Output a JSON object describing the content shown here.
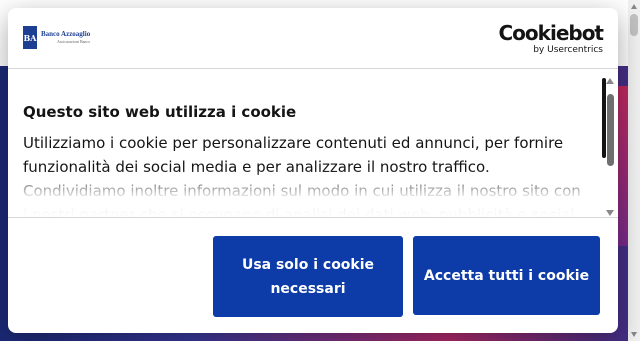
{
  "brand": {
    "mark": "BA",
    "name": "Banco Azzoaglio",
    "subtitle": "Assicurazioni Banco"
  },
  "cookiebot": {
    "word": "Cookiebot",
    "by": "by Usercentrics"
  },
  "consent": {
    "title": "Questo sito web utilizza i cookie",
    "text": "Utilizziamo i cookie per personalizzare contenuti ed annunci, per fornire funzionalità dei social media e per analizzare il nostro traffico. Condividiamo inoltre informazioni sul modo in cui utilizza il nostro sito con i nostri partner che si occupano di analisi dei dati web, pubblicità e social media."
  },
  "buttons": {
    "necessary": "Usa solo i cookie necessari",
    "accept_all": "Accetta tutti i cookie"
  },
  "colors": {
    "primary": "#0d3ba8",
    "brand": "#1d3f93",
    "text": "#141414"
  }
}
